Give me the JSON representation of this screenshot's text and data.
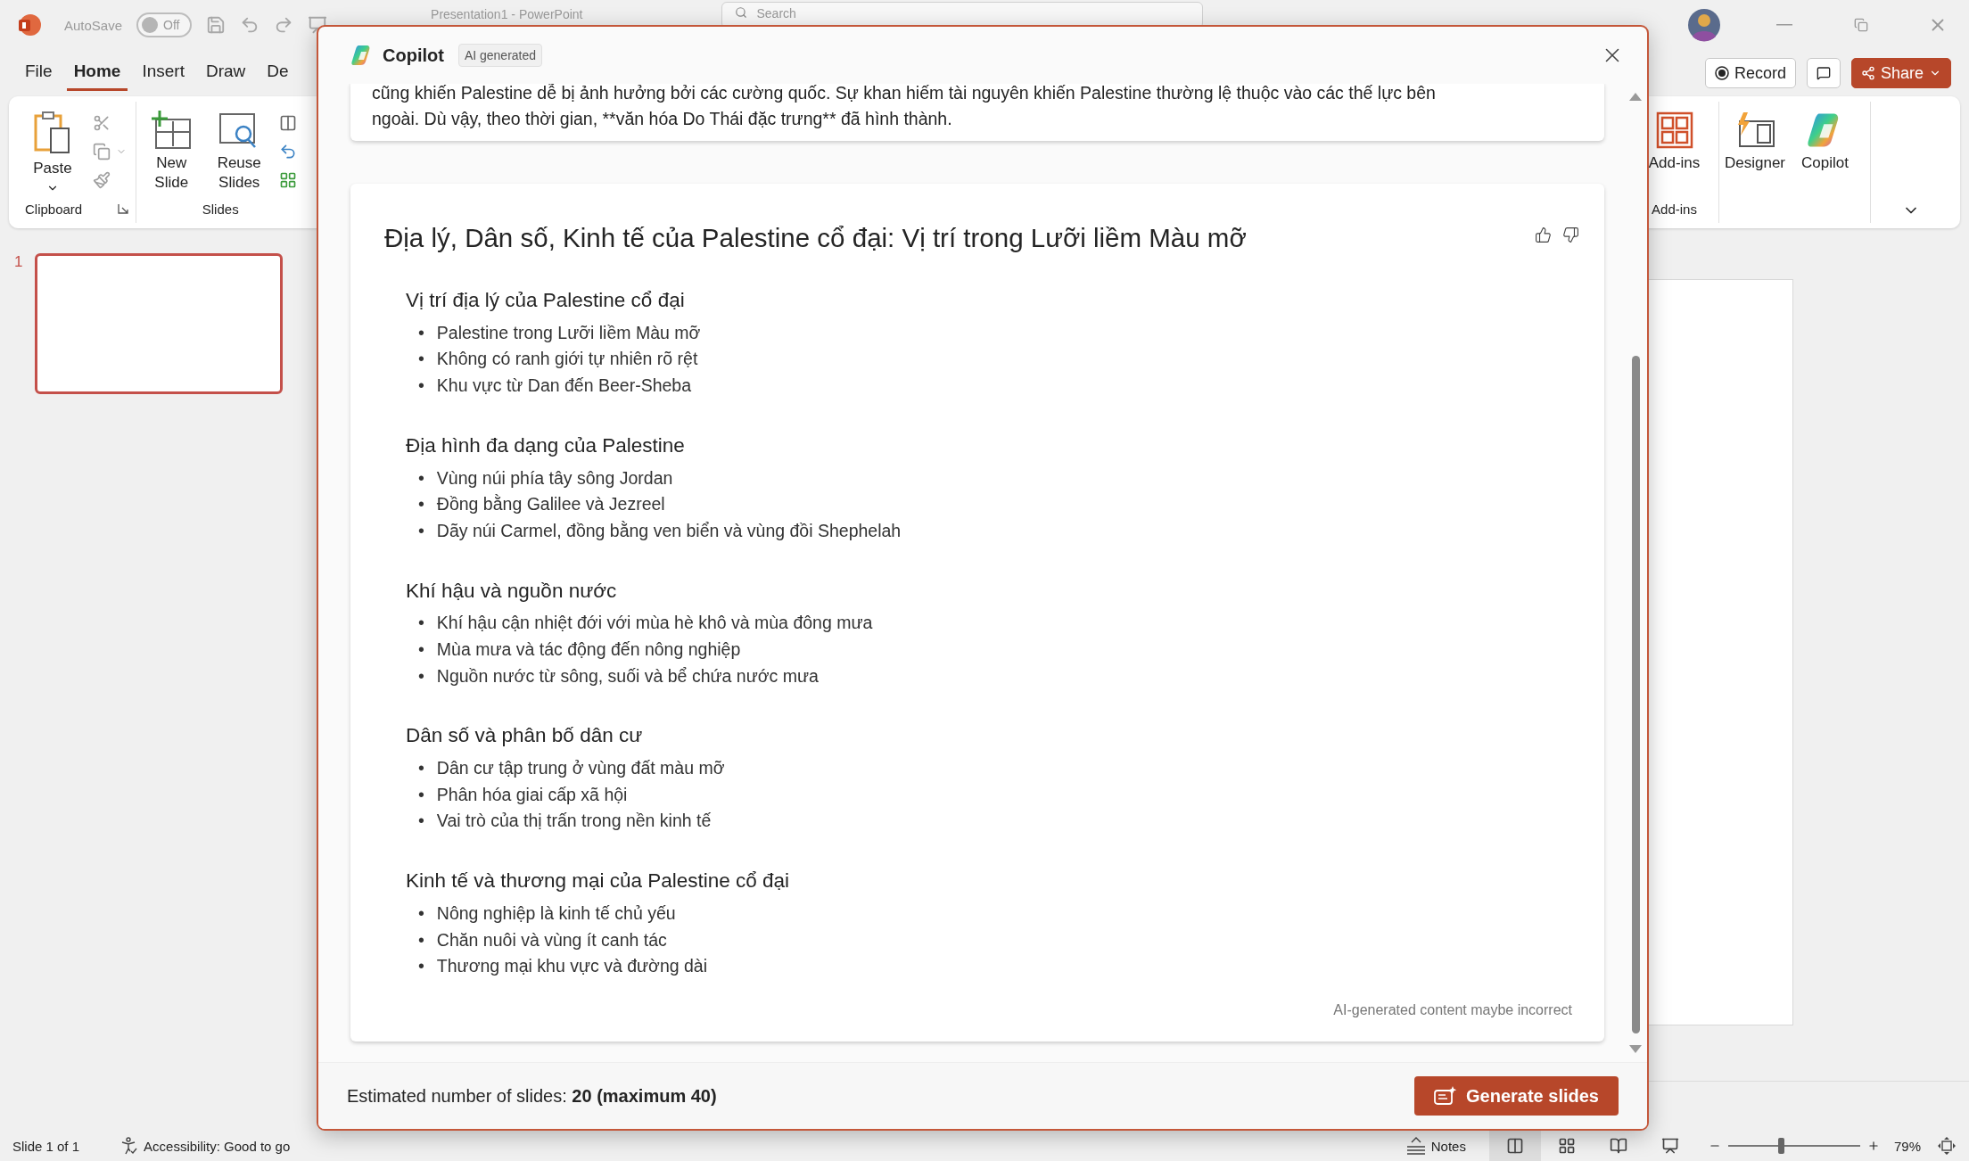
{
  "app": {
    "title": "Presentation1 - PowerPoint",
    "search_placeholder": "Search",
    "autosave": {
      "label": "AutoSave",
      "on": false,
      "state": "Off"
    }
  },
  "menu_tabs": [
    {
      "label": "File",
      "selected": false
    },
    {
      "label": "Home",
      "selected": true
    },
    {
      "label": "Insert",
      "selected": false
    },
    {
      "label": "Draw",
      "selected": false
    },
    {
      "label": "De",
      "selected": false
    }
  ],
  "clipboard": {
    "label": "Clipboard",
    "paste": "Paste"
  },
  "slides_group": {
    "label": "Slides",
    "new_slide": "New Slide",
    "reuse_slides": "Reuse Slides"
  },
  "actions": {
    "record": "Record",
    "share": "Share"
  },
  "ribbon_right": {
    "group_label": "Add-ins",
    "buttons": [
      {
        "kind": "addins",
        "label": "Add-ins"
      },
      {
        "kind": "designer",
        "label": "Designer"
      },
      {
        "kind": "copilot",
        "label": "Copilot"
      }
    ]
  },
  "thumbnails": [
    {
      "number": "1",
      "selected": true
    }
  ],
  "dialog": {
    "title": "Copilot",
    "badge": "AI generated",
    "previous_text": "cũng khiến Palestine dễ bị ảnh hưởng bởi các cường quốc. Sự khan hiếm tài nguyên khiến Palestine thường lệ thuộc vào các thế lực bên ngoài. Dù vậy, theo thời gian, **văn hóa Do Thái đặc trưng** đã hình thành.",
    "outline": {
      "marker": "•",
      "title": "Địa lý, Dân số, Kinh tế của Palestine cổ đại: Vị trí trong Lưỡi liềm Màu mỡ",
      "sections": [
        {
          "heading": "Vị trí địa lý của Palestine cổ đại",
          "bullets": [
            "Palestine trong Lưỡi liềm Màu mỡ",
            "Không có ranh giới tự nhiên rõ rệt",
            "Khu vực từ Dan đến Beer-Sheba"
          ]
        },
        {
          "heading": "Địa hình đa dạng của Palestine",
          "bullets": [
            "Vùng núi phía tây sông Jordan",
            "Đồng bằng Galilee và Jezreel",
            "Dãy núi Carmel, đồng bằng ven biển và vùng đồi Shephelah"
          ]
        },
        {
          "heading": "Khí hậu và nguồn nước",
          "bullets": [
            "Khí hậu cận nhiệt đới với mùa hè khô và mùa đông mưa",
            "Mùa mưa và tác động đến nông nghiệp",
            "Nguồn nước từ sông, suối và bể chứa nước mưa"
          ]
        },
        {
          "heading": "Dân số và phân bố dân cư",
          "bullets": [
            "Dân cư tập trung ở vùng đất màu mỡ",
            "Phân hóa giai cấp xã hội",
            "Vai trò của thị trấn trong nền kinh tế"
          ]
        },
        {
          "heading": "Kinh tế và thương mại của Palestine cổ đại",
          "bullets": [
            "Nông nghiệp là kinh tế chủ yếu",
            "Chăn nuôi và vùng ít canh tác",
            "Thương mại khu vực và đường dài"
          ]
        }
      ]
    },
    "disclaimer": "AI-generated content maybe incorrect",
    "estimate": "Estimated number of slides: **20 (maximum 40)**",
    "generate": "Generate slides"
  },
  "status_bar": {
    "slide": "Slide 1 of 1",
    "accessibility": "Accessibility: Good to go",
    "notes": "Notes",
    "views": [
      {
        "kind": "normal",
        "selected": true
      },
      {
        "kind": "sorter",
        "selected": false
      },
      {
        "kind": "reading",
        "selected": false
      },
      {
        "kind": "presenter",
        "selected": false
      }
    ],
    "zoom": {
      "level": 0.4,
      "reading": "79%"
    }
  }
}
